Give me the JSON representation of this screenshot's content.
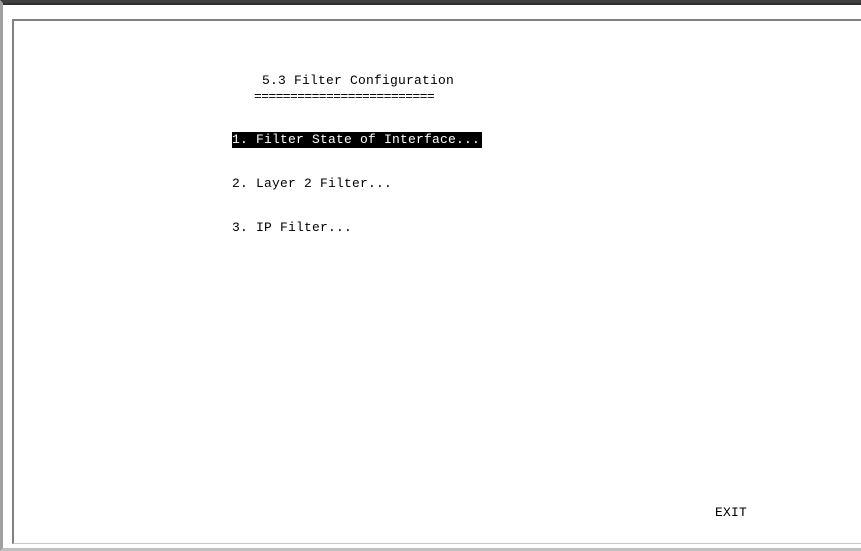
{
  "screen": {
    "title": "5.3 Filter Configuration",
    "title_underline": "=========================",
    "menu": [
      {
        "label": "1. Filter State of Interface...",
        "selected": true
      },
      {
        "label": "2. Layer 2 Filter...",
        "selected": false
      },
      {
        "label": "3. IP Filter...",
        "selected": false
      }
    ],
    "exit_label": "EXIT"
  },
  "colors": {
    "background": "#ffffff",
    "text": "#000000",
    "selection_background": "#000000",
    "selection_text": "#ffffff"
  }
}
